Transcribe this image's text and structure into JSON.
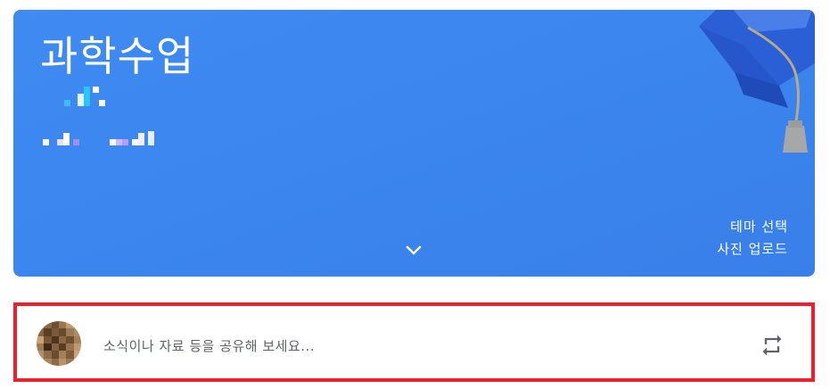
{
  "banner": {
    "class_title": "과학수업",
    "theme_link": "테마 선택",
    "upload_link": "사진 업로드",
    "background_color": "#3b86ef",
    "expand_icon": "chevron-down-icon",
    "illustration_icon": "graduation-cap-icon"
  },
  "post_box": {
    "placeholder": "소식이나 자료 등을 공유해 보세요...",
    "highlight_color": "#ef1f2f",
    "repost_icon": "repost-icon",
    "avatar_icon": "user-avatar"
  }
}
